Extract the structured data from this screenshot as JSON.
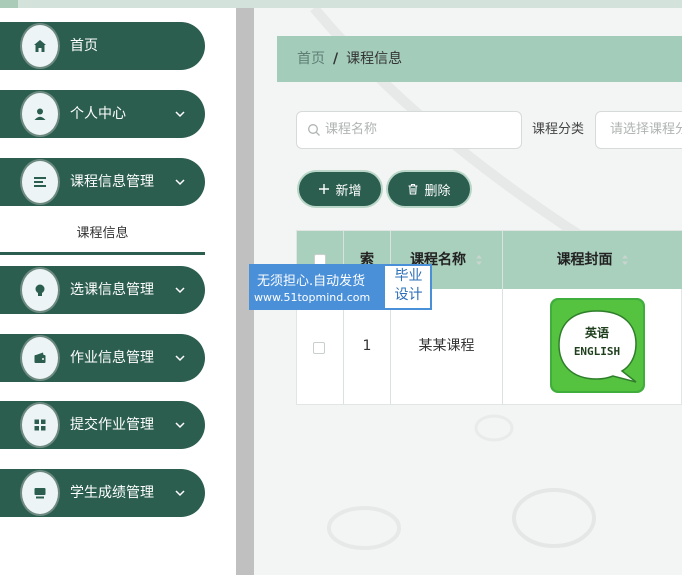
{
  "sidebar": {
    "items": [
      {
        "label": "首页",
        "icon": "home-icon"
      },
      {
        "label": "个人中心",
        "icon": "user-icon"
      },
      {
        "label": "课程信息管理",
        "icon": "list-icon"
      },
      {
        "label": "选课信息管理",
        "icon": "bulb-icon"
      },
      {
        "label": "作业信息管理",
        "icon": "wallet-icon"
      },
      {
        "label": "提交作业管理",
        "icon": "grid-icon"
      },
      {
        "label": "学生成绩管理",
        "icon": "monitor-icon"
      }
    ],
    "submenu_label": "课程信息"
  },
  "breadcrumb": {
    "home": "首页",
    "separator": "/",
    "current": "课程信息"
  },
  "search": {
    "placeholder": "课程名称",
    "filter_label": "课程分类",
    "filter_placeholder": "请选择课程分类"
  },
  "toolbar": {
    "add_label": "新增",
    "delete_label": "删除"
  },
  "table": {
    "headers": [
      "索",
      "课程名称",
      "课程封面"
    ],
    "rows": [
      {
        "index": "1",
        "name": "某某课程",
        "cover_text_top": "英语",
        "cover_text_bottom": "ENGLISH"
      }
    ]
  },
  "watermark": {
    "title": "无须担心.自动发货",
    "url": "www.51topmind.com",
    "side_1": "毕业",
    "side_2": "设计"
  },
  "colors": {
    "primary": "#2b5e4f",
    "header": "#a9cfbd",
    "accent": "#a3ccbb"
  }
}
